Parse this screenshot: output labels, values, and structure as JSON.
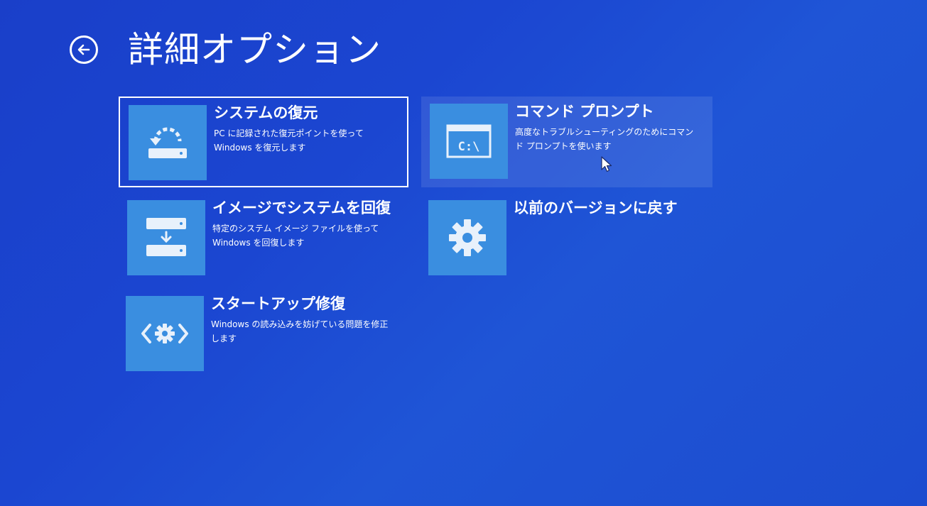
{
  "header": {
    "title": "詳細オプション"
  },
  "options": [
    {
      "title": "システムの復元",
      "description": "PC に記録された復元ポイントを使って Windows を復元します",
      "icon": "system-restore-icon",
      "selected": true
    },
    {
      "title": "コマンド プロンプト",
      "description": "高度なトラブルシューティングのためにコマンド プロンプトを使います",
      "icon": "command-prompt-icon",
      "icon_text": "C:\\",
      "hovered": true
    },
    {
      "title": "イメージでシステムを回復",
      "description": "特定のシステム イメージ ファイルを使って Windows を回復します",
      "icon": "system-image-recovery-icon"
    },
    {
      "title": "以前のバージョンに戻す",
      "description": "",
      "icon": "gear-icon"
    },
    {
      "title": "スタートアップ修復",
      "description": "Windows の読み込みを妨げている問題を修正します",
      "icon": "startup-repair-icon"
    }
  ],
  "colors": {
    "background": "#1b46d1",
    "tile": "#3a8ee0",
    "text": "#ffffff"
  }
}
